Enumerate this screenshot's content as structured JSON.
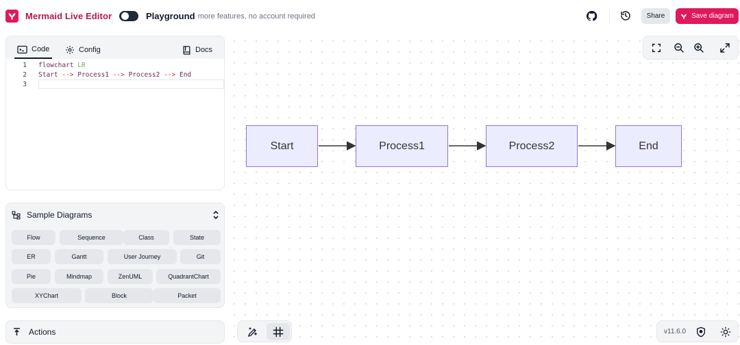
{
  "header": {
    "app_title": "Mermaid Live Editor",
    "playground_title": "Playground",
    "playground_subtitle": "- more features, no account required",
    "share_label": "Share",
    "save_label": "Save diagram",
    "colors": {
      "brand": "#e0185c",
      "title": "#b5174f"
    }
  },
  "editor": {
    "tabs": {
      "code": "Code",
      "config": "Config",
      "docs": "Docs"
    },
    "lines": [
      {
        "num": "1",
        "tokens": [
          "flowchart",
          " ",
          "LR"
        ]
      },
      {
        "num": "2",
        "tokens": [
          "Start",
          " --> ",
          "Process1",
          " --> ",
          "Process2",
          " --> ",
          "End"
        ]
      },
      {
        "num": "3",
        "tokens": []
      }
    ]
  },
  "samples": {
    "title": "Sample Diagrams",
    "chips": [
      "Flow",
      "Sequence",
      "Class",
      "State",
      "ER",
      "Gantt",
      "User Journey",
      "Git",
      "Pie",
      "Mindmap",
      "ZenUML",
      "QuadrantChart",
      "XYChart",
      "Block",
      "Packet"
    ]
  },
  "actions": {
    "label": "Actions"
  },
  "diagram": {
    "direction": "LR",
    "nodes": [
      "Start",
      "Process1",
      "Process2",
      "End"
    ],
    "edges": [
      [
        "Start",
        "Process1"
      ],
      [
        "Process1",
        "Process2"
      ],
      [
        "Process2",
        "End"
      ]
    ],
    "node_fill": "#ececff",
    "node_stroke": "#9370db"
  },
  "footer": {
    "version": "v11.6.0"
  },
  "icons": {
    "header": [
      "mermaid-logo-icon",
      "github-icon",
      "history-icon",
      "save-mermaid-icon"
    ],
    "zoom_bar": [
      "fit-screen-icon",
      "zoom-out-icon",
      "zoom-in-icon",
      "fullscreen-icon"
    ],
    "bottom_tools": [
      "pan-edit-icon",
      "grid-icon"
    ],
    "version_bar": [
      "shield-icon",
      "theme-sun-icon"
    ]
  }
}
